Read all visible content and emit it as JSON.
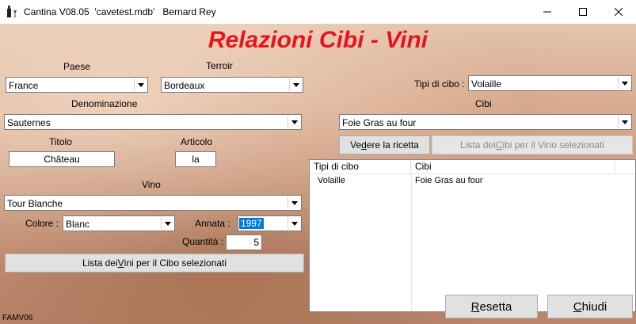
{
  "window": {
    "title": "Cantina V08.05  'cavetest.mdb'   Bernard Rey"
  },
  "heading": "Relazioni Cibi - Vini",
  "left": {
    "paese_label": "Paese",
    "paese_value": "France",
    "terroir_label": "Terroir",
    "terroir_value": "Bordeaux",
    "denominazione_label": "Denominazione",
    "denominazione_value": "Sauternes",
    "titolo_label": "Titolo",
    "titolo_value": "Château",
    "articolo_label": "Articolo",
    "articolo_value": "la",
    "vino_label": "Vino",
    "vino_value": "Tour Blanche",
    "colore_label": "Colore :",
    "colore_value": "Blanc",
    "annata_label": "Annata :",
    "annata_value": "1997",
    "quantita_label": "Quantità :",
    "quantita_value": "5",
    "lista_vini_button_pre": "Lista dei ",
    "lista_vini_button_key": "V",
    "lista_vini_button_post": "ini per il Cibo selezionati"
  },
  "right": {
    "tipi_label": "Tipi di cibo :",
    "tipi_value": "Volaille",
    "cibi_label": "Cibi",
    "cibi_value": "Foie Gras au four",
    "vedere_button_pre": "Ve",
    "vedere_button_key": "d",
    "vedere_button_post": "ere la ricetta",
    "lista_cibi_button_pre": "Lista dei ",
    "lista_cibi_button_key": "C",
    "lista_cibi_button_post": "ibi per il Vino selezionati",
    "table": {
      "columns": [
        "Tipi di cibo",
        "Cibi"
      ],
      "rows": [
        {
          "tipo": "Volaille",
          "cibo": "Foie Gras au four"
        }
      ]
    }
  },
  "buttons": {
    "resetta_key": "R",
    "resetta_rest": "esetta",
    "chiudi_key": "C",
    "chiudi_rest": "hiudi"
  },
  "footer": "FAMV06"
}
